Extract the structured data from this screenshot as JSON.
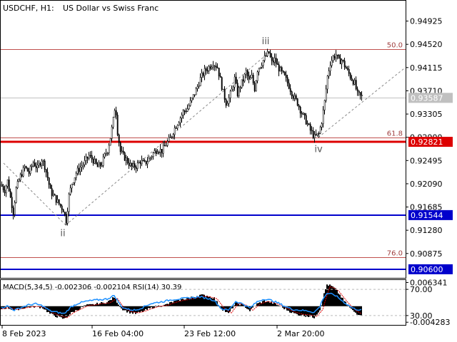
{
  "header": {
    "symbol": "USDCHF, H1:",
    "description": "US Dollar vs Swiss Franc"
  },
  "colors": {
    "candle": "#000000",
    "fib_line": "#c0504d",
    "fib_label": "#a04040",
    "support_resistance_red": "#dd0000",
    "support_blue": "#0000cc",
    "current_price_line": "#c0c0c0",
    "current_price_label_bg": "#c0c0c0",
    "macd_histogram": "#000000",
    "macd_signal": "#dd0000",
    "rsi_line": "#1e90ff",
    "axis_text": "#000000"
  },
  "chart_data": [
    {
      "type": "candlestick",
      "price_axis": {
        "ticks": [
          "0.94925",
          "0.94520",
          "0.94115",
          "0.93710",
          "0.93305",
          "0.92900",
          "0.92495",
          "0.92090",
          "0.91685",
          "0.91280",
          "0.90875"
        ],
        "ylim": [
          0.9045,
          0.9528
        ]
      },
      "time_axis": {
        "ticks": [
          "8 Feb 2023",
          "16 Feb 04:00",
          "23 Feb 12:00",
          "2 Mar 20:00"
        ]
      },
      "price_path": [
        [
          0,
          0.9208
        ],
        [
          6,
          0.9198
        ],
        [
          10,
          0.9214
        ],
        [
          14,
          0.9185
        ],
        [
          18,
          0.916
        ],
        [
          22,
          0.92
        ],
        [
          28,
          0.9222
        ],
        [
          34,
          0.9238
        ],
        [
          40,
          0.9228
        ],
        [
          46,
          0.9246
        ],
        [
          52,
          0.9236
        ],
        [
          58,
          0.9252
        ],
        [
          62,
          0.924
        ],
        [
          66,
          0.922
        ],
        [
          70,
          0.9196
        ],
        [
          76,
          0.9185
        ],
        [
          82,
          0.9174
        ],
        [
          88,
          0.9164
        ],
        [
          92,
          0.9145
        ],
        [
          96,
          0.9188
        ],
        [
          100,
          0.921
        ],
        [
          106,
          0.9228
        ],
        [
          112,
          0.9238
        ],
        [
          118,
          0.9246
        ],
        [
          124,
          0.9258
        ],
        [
          130,
          0.925
        ],
        [
          136,
          0.9238
        ],
        [
          142,
          0.9244
        ],
        [
          146,
          0.9258
        ],
        [
          150,
          0.9268
        ],
        [
          154,
          0.929
        ],
        [
          158,
          0.932
        ],
        [
          161,
          0.935
        ],
        [
          164,
          0.93
        ],
        [
          168,
          0.9265
        ],
        [
          172,
          0.9258
        ],
        [
          178,
          0.9248
        ],
        [
          184,
          0.9238
        ],
        [
          190,
          0.924
        ],
        [
          196,
          0.9248
        ],
        [
          202,
          0.9244
        ],
        [
          208,
          0.9252
        ],
        [
          214,
          0.9262
        ],
        [
          220,
          0.927
        ],
        [
          226,
          0.9266
        ],
        [
          232,
          0.9278
        ],
        [
          238,
          0.9288
        ],
        [
          244,
          0.9306
        ],
        [
          250,
          0.932
        ],
        [
          256,
          0.9334
        ],
        [
          262,
          0.934
        ],
        [
          268,
          0.9356
        ],
        [
          274,
          0.9372
        ],
        [
          280,
          0.9392
        ],
        [
          286,
          0.9405
        ],
        [
          292,
          0.9412
        ],
        [
          298,
          0.942
        ],
        [
          304,
          0.9412
        ],
        [
          308,
          0.939
        ],
        [
          312,
          0.9368
        ],
        [
          316,
          0.935
        ],
        [
          320,
          0.9358
        ],
        [
          324,
          0.9372
        ],
        [
          328,
          0.9392
        ],
        [
          332,
          0.9366
        ],
        [
          336,
          0.938
        ],
        [
          340,
          0.939
        ],
        [
          344,
          0.9404
        ],
        [
          348,
          0.9388
        ],
        [
          352,
          0.9395
        ],
        [
          356,
          0.9375
        ],
        [
          360,
          0.9408
        ],
        [
          366,
          0.942
        ],
        [
          372,
          0.9432
        ],
        [
          376,
          0.9437
        ],
        [
          380,
          0.942
        ],
        [
          384,
          0.9425
        ],
        [
          388,
          0.9414
        ],
        [
          392,
          0.9406
        ],
        [
          398,
          0.9395
        ],
        [
          404,
          0.938
        ],
        [
          410,
          0.9362
        ],
        [
          416,
          0.935
        ],
        [
          422,
          0.9332
        ],
        [
          428,
          0.9318
        ],
        [
          434,
          0.9302
        ],
        [
          440,
          0.929
        ],
        [
          446,
          0.9296
        ],
        [
          450,
          0.9318
        ],
        [
          454,
          0.9352
        ],
        [
          458,
          0.9396
        ],
        [
          462,
          0.942
        ],
        [
          466,
          0.943
        ],
        [
          470,
          0.9434
        ],
        [
          474,
          0.9422
        ],
        [
          478,
          0.9425
        ],
        [
          484,
          0.941
        ],
        [
          490,
          0.9396
        ],
        [
          496,
          0.9384
        ],
        [
          500,
          0.9365
        ],
        [
          506,
          0.936
        ]
      ],
      "fib_levels": [
        {
          "label": "50.0",
          "price": 0.94438
        },
        {
          "label": "61.8",
          "price": 0.929
        },
        {
          "label": "76.0",
          "price": 0.90805
        }
      ],
      "horizontal_levels": [
        {
          "price": 0.92821,
          "label": "0.92821",
          "color": "#dd0000",
          "width": 3
        },
        {
          "price": 0.91544,
          "label": "0.91544",
          "color": "#0000cc",
          "width": 2
        },
        {
          "price": 0.906,
          "label": "0.90600",
          "color": "#0000cc",
          "width": 2
        }
      ],
      "current_price": {
        "price": 0.93587,
        "label": "0.93587"
      },
      "wave_labels": [
        {
          "label": "ii",
          "x": 88,
          "price": 0.91175
        },
        {
          "label": "iii",
          "x": 372,
          "price": 0.94525
        },
        {
          "label": "iv",
          "x": 446,
          "price": 0.9264
        }
      ],
      "dashed_trend": [
        [
          [
            5,
            0.9245
          ],
          [
            92,
            0.9137
          ]
        ],
        [
          [
            92,
            0.9137
          ],
          [
            376,
            0.9437
          ]
        ],
        [
          [
            446,
            0.929
          ],
          [
            566,
            0.941
          ]
        ]
      ]
    },
    {
      "type": "oscillator",
      "title": "MACD(5,34,5) -0.002306 -0.002104 RSI(14) 30.39",
      "right_axis": {
        "ticks": [
          {
            "label": "0.006341",
            "level": 0.006341
          },
          {
            "label": "70.00",
            "level": 0.0045
          },
          {
            "label": "30.00",
            "level": -0.0025
          },
          {
            "label": "-0.004283",
            "level": -0.004283
          }
        ],
        "ylim": [
          -0.005,
          0.007
        ]
      },
      "macd_points": [
        [
          0,
          -0.0008
        ],
        [
          10,
          -0.0004
        ],
        [
          20,
          -0.001
        ],
        [
          30,
          -0.0006
        ],
        [
          40,
          -0.0002
        ],
        [
          50,
          -0.0001
        ],
        [
          60,
          -0.0004
        ],
        [
          70,
          -0.002
        ],
        [
          80,
          -0.0028
        ],
        [
          90,
          -0.0034
        ],
        [
          100,
          -0.0018
        ],
        [
          110,
          -0.0008
        ],
        [
          120,
          0.0002
        ],
        [
          130,
          0.0004
        ],
        [
          140,
          0.0008
        ],
        [
          150,
          0.001
        ],
        [
          160,
          0.0024
        ],
        [
          170,
          -0.0006
        ],
        [
          180,
          -0.0016
        ],
        [
          190,
          -0.002
        ],
        [
          200,
          -0.0014
        ],
        [
          210,
          -0.0006
        ],
        [
          220,
          0.0
        ],
        [
          230,
          0.0002
        ],
        [
          240,
          0.001
        ],
        [
          250,
          0.0016
        ],
        [
          260,
          0.002
        ],
        [
          270,
          0.0024
        ],
        [
          280,
          0.003
        ],
        [
          290,
          0.0028
        ],
        [
          300,
          0.0022
        ],
        [
          310,
          -0.0006
        ],
        [
          320,
          -0.002
        ],
        [
          330,
          0.0008
        ],
        [
          340,
          0.0004
        ],
        [
          350,
          -0.0012
        ],
        [
          360,
          0.0006
        ],
        [
          370,
          0.0014
        ],
        [
          380,
          0.001
        ],
        [
          390,
          0.0002
        ],
        [
          400,
          -0.0008
        ],
        [
          410,
          -0.0018
        ],
        [
          420,
          -0.0024
        ],
        [
          430,
          -0.0026
        ],
        [
          440,
          -0.003
        ],
        [
          448,
          -0.001
        ],
        [
          452,
          0.002
        ],
        [
          458,
          0.0058
        ],
        [
          464,
          0.0054
        ],
        [
          470,
          0.0046
        ],
        [
          476,
          0.003
        ],
        [
          482,
          0.0014
        ],
        [
          488,
          0.0
        ],
        [
          494,
          -0.0012
        ],
        [
          500,
          -0.002
        ],
        [
          506,
          -0.0023
        ]
      ],
      "rsi_points": [
        [
          0,
          35
        ],
        [
          10,
          42
        ],
        [
          20,
          30
        ],
        [
          30,
          38
        ],
        [
          40,
          45
        ],
        [
          50,
          48
        ],
        [
          60,
          42
        ],
        [
          70,
          28
        ],
        [
          80,
          24
        ],
        [
          90,
          20
        ],
        [
          100,
          40
        ],
        [
          110,
          50
        ],
        [
          120,
          55
        ],
        [
          130,
          58
        ],
        [
          140,
          60
        ],
        [
          150,
          62
        ],
        [
          160,
          72
        ],
        [
          170,
          40
        ],
        [
          180,
          32
        ],
        [
          190,
          30
        ],
        [
          200,
          38
        ],
        [
          210,
          48
        ],
        [
          220,
          52
        ],
        [
          230,
          55
        ],
        [
          240,
          60
        ],
        [
          250,
          62
        ],
        [
          260,
          64
        ],
        [
          270,
          66
        ],
        [
          280,
          68
        ],
        [
          290,
          64
        ],
        [
          300,
          58
        ],
        [
          310,
          34
        ],
        [
          320,
          30
        ],
        [
          330,
          55
        ],
        [
          340,
          48
        ],
        [
          350,
          36
        ],
        [
          360,
          54
        ],
        [
          370,
          62
        ],
        [
          380,
          58
        ],
        [
          390,
          50
        ],
        [
          400,
          40
        ],
        [
          410,
          32
        ],
        [
          420,
          30
        ],
        [
          430,
          28
        ],
        [
          440,
          24
        ],
        [
          448,
          40
        ],
        [
          452,
          62
        ],
        [
          458,
          78
        ],
        [
          464,
          76
        ],
        [
          470,
          72
        ],
        [
          476,
          62
        ],
        [
          482,
          52
        ],
        [
          488,
          44
        ],
        [
          494,
          36
        ],
        [
          500,
          32
        ],
        [
          506,
          30.39
        ]
      ]
    }
  ]
}
